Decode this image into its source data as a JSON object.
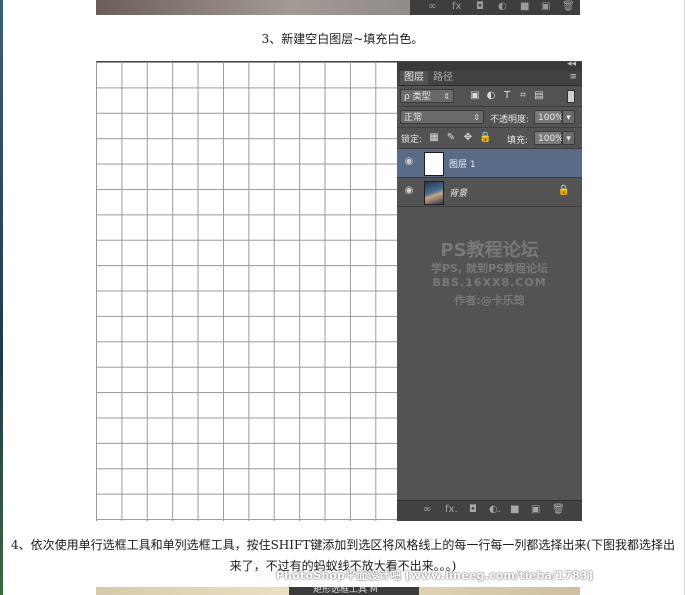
{
  "caption_step3": "3、新建空白图层~填充白色。",
  "caption_step4": "4、依次使用单行选框工具和单列选框工具，按住SHIFT键添加到选区将风格线上的每一行每一列都选择出来(下图我都选择出来了，不过有的蚂蚁线不放大看不出来。。。)",
  "prev_panel_icons": [
    "∞",
    "fx",
    "◘",
    "◐",
    "■",
    "▣",
    "🗑"
  ],
  "panel": {
    "collapse": "◂◂",
    "tabs": [
      "图层",
      "路径"
    ],
    "filter_label": "ρ 类型",
    "blend_mode": "正常",
    "opacity_label": "不透明度:",
    "opacity_value": "100%",
    "lock_label": "锁定:",
    "fill_label": "填充:",
    "fill_value": "100%",
    "layers": [
      {
        "name": "图层 1",
        "selected": true
      },
      {
        "name": "背景",
        "selected": false
      }
    ],
    "bottom_icons": [
      "∞",
      "fx.",
      "◘",
      "◐.",
      "■",
      "▣",
      "🗑"
    ]
  },
  "watermark": {
    "title": "PS教程论坛",
    "line1": "学PS, 就到PS教程论坛",
    "line2": "BBS.16XX8.COM",
    "line3": "作者:@卡乐筠"
  },
  "footer_watermark": "PhotoShop平面设计吧 [www.lineeg.com/tieba/1783]",
  "next_image_menu": "矩形选框工具  M"
}
